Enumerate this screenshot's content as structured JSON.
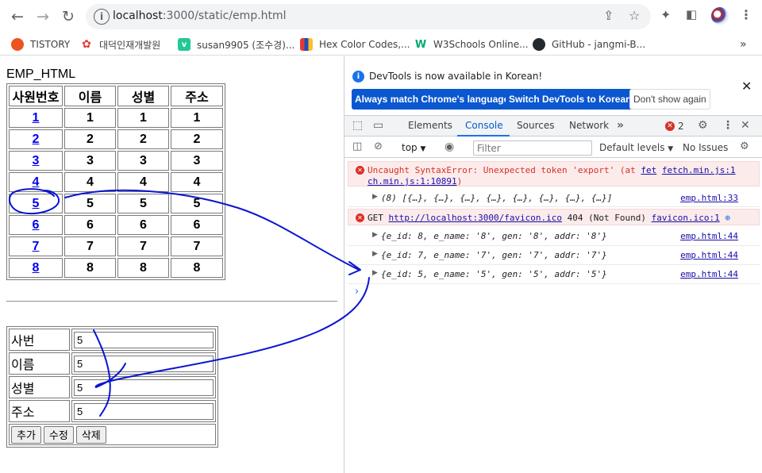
{
  "browser": {
    "url_host": "localhost",
    "url_path": ":3000/static/emp.html",
    "bookmarks": [
      {
        "label": "TISTORY",
        "icon": "tistory-icon",
        "color": "#eb531f",
        "glyph": "●"
      },
      {
        "label": "대덕인재개발원",
        "icon": "ddit-icon",
        "color": "#e8eaed",
        "glyph": "✿"
      },
      {
        "label": "susan9905 (조수경)...",
        "icon": "velog-icon",
        "color": "#20c997",
        "glyph": "v"
      },
      {
        "label": "Hex Color Codes,...",
        "icon": "hexcolor-icon",
        "color": "#1e4fb4",
        "glyph": "▮"
      },
      {
        "label": "W3Schools Online...",
        "icon": "w3schools-icon",
        "color": "#04aa6d",
        "glyph": "W"
      },
      {
        "label": "GitHub - jangmi-B...",
        "icon": "github-icon",
        "color": "#24292f",
        "glyph": "●"
      }
    ]
  },
  "page": {
    "title": "EMP_HTML",
    "headers": [
      "사원번호",
      "이름",
      "성별",
      "주소"
    ],
    "rows": [
      [
        "1",
        "1",
        "1",
        "1"
      ],
      [
        "2",
        "2",
        "2",
        "2"
      ],
      [
        "3",
        "3",
        "3",
        "3"
      ],
      [
        "4",
        "4",
        "4",
        "4"
      ],
      [
        "5",
        "5",
        "5",
        "5"
      ],
      [
        "6",
        "6",
        "6",
        "6"
      ],
      [
        "7",
        "7",
        "7",
        "7"
      ],
      [
        "8",
        "8",
        "8",
        "8"
      ]
    ],
    "form": {
      "fields": [
        {
          "label": "사번",
          "value": "5"
        },
        {
          "label": "이름",
          "value": "5"
        },
        {
          "label": "성별",
          "value": "5"
        },
        {
          "label": "주소",
          "value": "5"
        }
      ],
      "buttons": {
        "add": "추가",
        "edit": "수정",
        "delete": "삭제"
      }
    }
  },
  "devtools": {
    "info_message": "DevTools is now available in Korean!",
    "btn_match": "Always match Chrome's language",
    "btn_switch": "Switch DevTools to Korean",
    "btn_dont_show": "Don't show again",
    "tabs": {
      "elements": "Elements",
      "console": "Console",
      "sources": "Sources",
      "network": "Network"
    },
    "error_count": "2",
    "context": "top",
    "filter_placeholder": "Filter",
    "levels": "Default levels",
    "issues": "No Issues",
    "log": {
      "err1_text": "Uncaught SyntaxError: Unexpected token 'export' (at",
      "err1_link1": "fet",
      "err1_link2": "fetch.min.js:1",
      "err1_link3": "ch.min.js:1:10891",
      "err1_close": ")",
      "array_summary": "(8) [{…}, {…}, {…}, {…}, {…}, {…}, {…}, {…}]",
      "array_src": "emp.html:33",
      "err2_get": "GET",
      "err2_url": "http://localhost:3000/favicon.ico",
      "err2_status": "404 (Not Found)",
      "err2_src": "favicon.ico:1",
      "objects": [
        {
          "text": "{e_id: 8, e_name: '8', gen: '8', addr: '8'}",
          "src": "emp.html:44"
        },
        {
          "text": "{e_id: 7, e_name: '7', gen: '7', addr: '7'}",
          "src": "emp.html:44"
        },
        {
          "text": "{e_id: 5, e_name: '5', gen: '5', addr: '5'}",
          "src": "emp.html:44"
        }
      ]
    }
  },
  "annotation": {
    "color": "#0a14d2"
  }
}
